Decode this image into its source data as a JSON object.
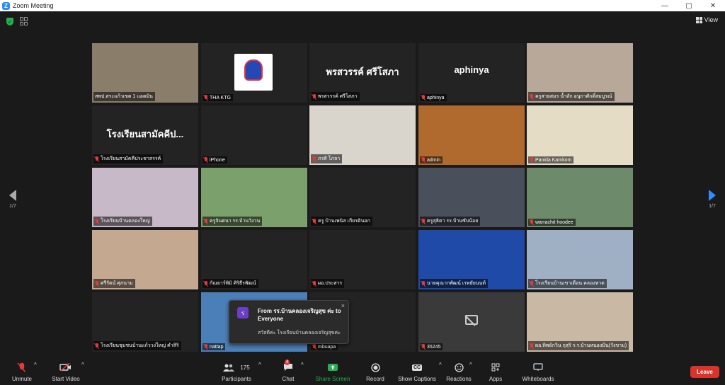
{
  "window": {
    "title": "Zoom Meeting",
    "controls": [
      "—",
      "▢",
      "✕"
    ]
  },
  "topbar": {
    "view_label": "View"
  },
  "nav": {
    "left_page": "1/7",
    "right_page": "1/7"
  },
  "tiles": [
    {
      "name": "สพป.สระแก้วเขต 1 แอดมิน",
      "muted": false,
      "bg": "#8a7e6a"
    },
    {
      "name": "THA KTG",
      "muted": true,
      "bg": "#232323"
    },
    {
      "name": "พรสวรรค์ ศรีโสภา",
      "muted": true,
      "bg": "#232323",
      "big": "พรสวรรค์ ศรีโสภา"
    },
    {
      "name": "aphinya",
      "muted": true,
      "bg": "#232323",
      "big": "aphinya"
    },
    {
      "name": "ครูสายสมร น้ำลัก อนุกาศักดิ์สมบูรณ์",
      "muted": true,
      "bg": "#b8a89a"
    },
    {
      "name": "โรงเรียนสามัคคีประชาสรรค์",
      "muted": true,
      "bg": "#232323",
      "big": "โรงเรียนสามัคคีป..."
    },
    {
      "name": "iPhone",
      "muted": true,
      "bg": "#232323"
    },
    {
      "name": "ภรสิ โภลา",
      "muted": true,
      "bg": "#d9d4cc"
    },
    {
      "name": "admin",
      "muted": true,
      "bg": "#b06a2e"
    },
    {
      "name": "Panida Kamkom",
      "muted": true,
      "bg": "#e4dcc4"
    },
    {
      "name": "โรงเรียนบ้านคลองใหญ่",
      "muted": true,
      "bg": "#c7b9c8"
    },
    {
      "name": "ครูจินตนา รร.บ้านวังวน",
      "muted": true,
      "bg": "#7ba06c"
    },
    {
      "name": "ครู บ้านเพนิส เกียรตินอก",
      "muted": true,
      "bg": "#232323"
    },
    {
      "name": "ครูสุธิดา รร.บ้านซับน้อย",
      "muted": true,
      "bg": "#4a4f5c"
    },
    {
      "name": "warrachit hoodee",
      "muted": true,
      "bg": "#6d8a6a"
    },
    {
      "name": "ศรีรัตน์ ศุภนาม",
      "muted": true,
      "bg": "#c4a890"
    },
    {
      "name": "กัณยาร์พิมิ ศิริธีรพัฒน์",
      "muted": true,
      "bg": "#232323"
    },
    {
      "name": "ผอ.ประสาร",
      "muted": true,
      "bg": "#232323"
    },
    {
      "name": "นายคุณากพัฒน์ เรหยัยนนท์",
      "muted": true,
      "bg": "#1f4aa8"
    },
    {
      "name": "โรงเรียนบ้านเขาเดือน คลองหาด",
      "muted": true,
      "bg": "#9fb0c4"
    },
    {
      "name": "โรงเรียนชุมชนบ้านแก้ววง่ใหญ่ คำสิริ",
      "muted": true,
      "bg": "#232323"
    },
    {
      "name": "nattap",
      "muted": true,
      "bg": "#4b7fb8"
    },
    {
      "name": "mbuapa",
      "muted": true,
      "bg": "#232323"
    },
    {
      "name": "35245",
      "muted": true,
      "bg": "#3a3a3a"
    },
    {
      "name": "ผอ.ทิพย์กวิน กุสุริ ร.ร.บ้านหนองมิ่น(วังขาม)",
      "muted": true,
      "bg": "#c9b8a4"
    }
  ],
  "chat": {
    "avatar_letter": "ร",
    "from_line": "From รร.บ้านคลองเจริญสุข ค่ะ to Everyone",
    "message": "สวัสดีค่ะ โรงเรียนบ้านคลองเจริญสุขค่ะ",
    "close": "×"
  },
  "toolbar": {
    "unmute": "Unmute",
    "start_video": "Start Video",
    "participants": "Participants",
    "participants_count": "175",
    "chat": "Chat",
    "chat_badge": "4",
    "share_screen": "Share Screen",
    "record": "Record",
    "show_captions": "Show Captions",
    "cc": "CC",
    "reactions": "Reactions",
    "apps": "Apps",
    "whiteboards": "Whiteboards",
    "leave": "Leave"
  },
  "colors": {
    "accent": "#2d8cff",
    "active_speaker": "#e8d23a",
    "leave": "#d9342b",
    "share": "#22b14c"
  }
}
